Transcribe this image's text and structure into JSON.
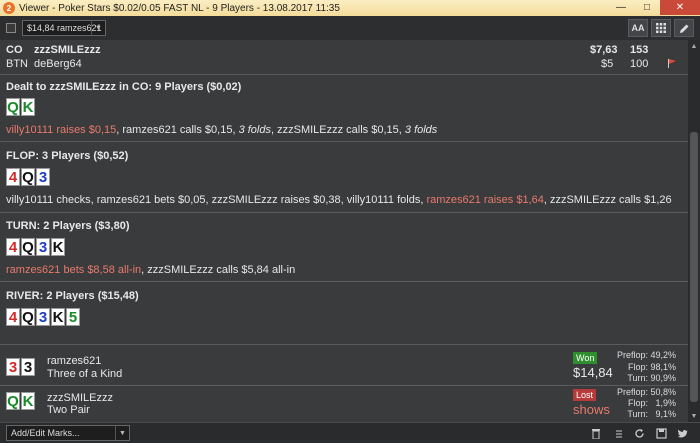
{
  "window": {
    "app_badge": "2",
    "title": "Viewer - Poker Stars $0.02/0.05 FAST NL - 9 Players - 13.08.2017 11:35",
    "minimize": "—",
    "maximize": "□",
    "close": "✕"
  },
  "toolbar": {
    "hand_select": "$14,84 ramzes621",
    "font_button": "AA",
    "grid_icon": "grid-icon",
    "edit_icon": "pencil-icon"
  },
  "players": [
    {
      "pos": "CO",
      "name": "zzzSMILEzzz",
      "stack": "$7,63",
      "bb": "153"
    },
    {
      "pos": "BTN",
      "name": "deBerg64",
      "stack": "$5",
      "bb": "100"
    }
  ],
  "preflop": {
    "header": "Dealt to zzzSMILEzzz in CO: 9 Players ($0,02)",
    "cards": [
      {
        "rank": "Q",
        "color": "#1a8a2a"
      },
      {
        "rank": "K",
        "color": "#1a8a2a"
      }
    ],
    "action_red": "villy10111 raises $0,15",
    "action_rest": ", ramzes621 calls $0,15, ",
    "folds1": "3 folds",
    "action_rest2": ", zzzSMILEzzz calls $0,15, ",
    "folds2": "3 folds"
  },
  "flop": {
    "header": "FLOP: 3 Players ($0,52)",
    "cards": [
      {
        "rank": "4",
        "color": "#d42a2a"
      },
      {
        "rank": "Q",
        "color": "#111111"
      },
      {
        "rank": "3",
        "color": "#1e3fbf"
      }
    ],
    "action_part1": "villy10111 checks, ramzes621 bets $0,05, zzzSMILEzzz raises $0,38, villy10111 folds, ",
    "action_red": "ramzes621 raises $1,64",
    "action_part2": ", zzzSMILEzzz calls $1,26"
  },
  "turn": {
    "header": "TURN: 2 Players ($3,80)",
    "cards": [
      {
        "rank": "4",
        "color": "#d42a2a"
      },
      {
        "rank": "Q",
        "color": "#111111"
      },
      {
        "rank": "3",
        "color": "#1e3fbf"
      },
      {
        "rank": "K",
        "color": "#111111"
      }
    ],
    "action_red": "ramzes621 bets $8,58 all-in",
    "action_rest": ", zzzSMILEzzz calls $5,84 all-in"
  },
  "river": {
    "header": "RIVER: 2 Players ($15,48)",
    "cards": [
      {
        "rank": "4",
        "color": "#d42a2a"
      },
      {
        "rank": "Q",
        "color": "#111111"
      },
      {
        "rank": "3",
        "color": "#1e3fbf"
      },
      {
        "rank": "K",
        "color": "#111111"
      },
      {
        "rank": "5",
        "color": "#1a8a2a"
      }
    ]
  },
  "showdown": [
    {
      "cards": [
        {
          "rank": "3",
          "color": "#d42a2a"
        },
        {
          "rank": "3",
          "color": "#111111"
        }
      ],
      "name": "ramzes621",
      "hand": "Three of a Kind",
      "result": "Won",
      "amount": "$14,84",
      "stats": [
        {
          "label": "Preflop:",
          "value": "49,2%"
        },
        {
          "label": "Flop:",
          "value": "98,1%"
        },
        {
          "label": "Turn:",
          "value": "90,9%"
        }
      ]
    },
    {
      "cards": [
        {
          "rank": "Q",
          "color": "#1a8a2a"
        },
        {
          "rank": "K",
          "color": "#1a8a2a"
        }
      ],
      "name": "zzzSMILEzzz",
      "hand": "Two Pair",
      "result": "Lost",
      "amount": "shows",
      "stats": [
        {
          "label": "Preflop:",
          "value": "50,8%"
        },
        {
          "label": "Flop:",
          "value": "1,9%"
        },
        {
          "label": "Turn:",
          "value": "9,1%"
        }
      ]
    }
  ],
  "statusbar": {
    "marks_select": "Add/Edit Marks..."
  },
  "colors": {
    "accent_red": "#e97a6c",
    "won": "#2f8f2f",
    "lost": "#b73a3a"
  }
}
